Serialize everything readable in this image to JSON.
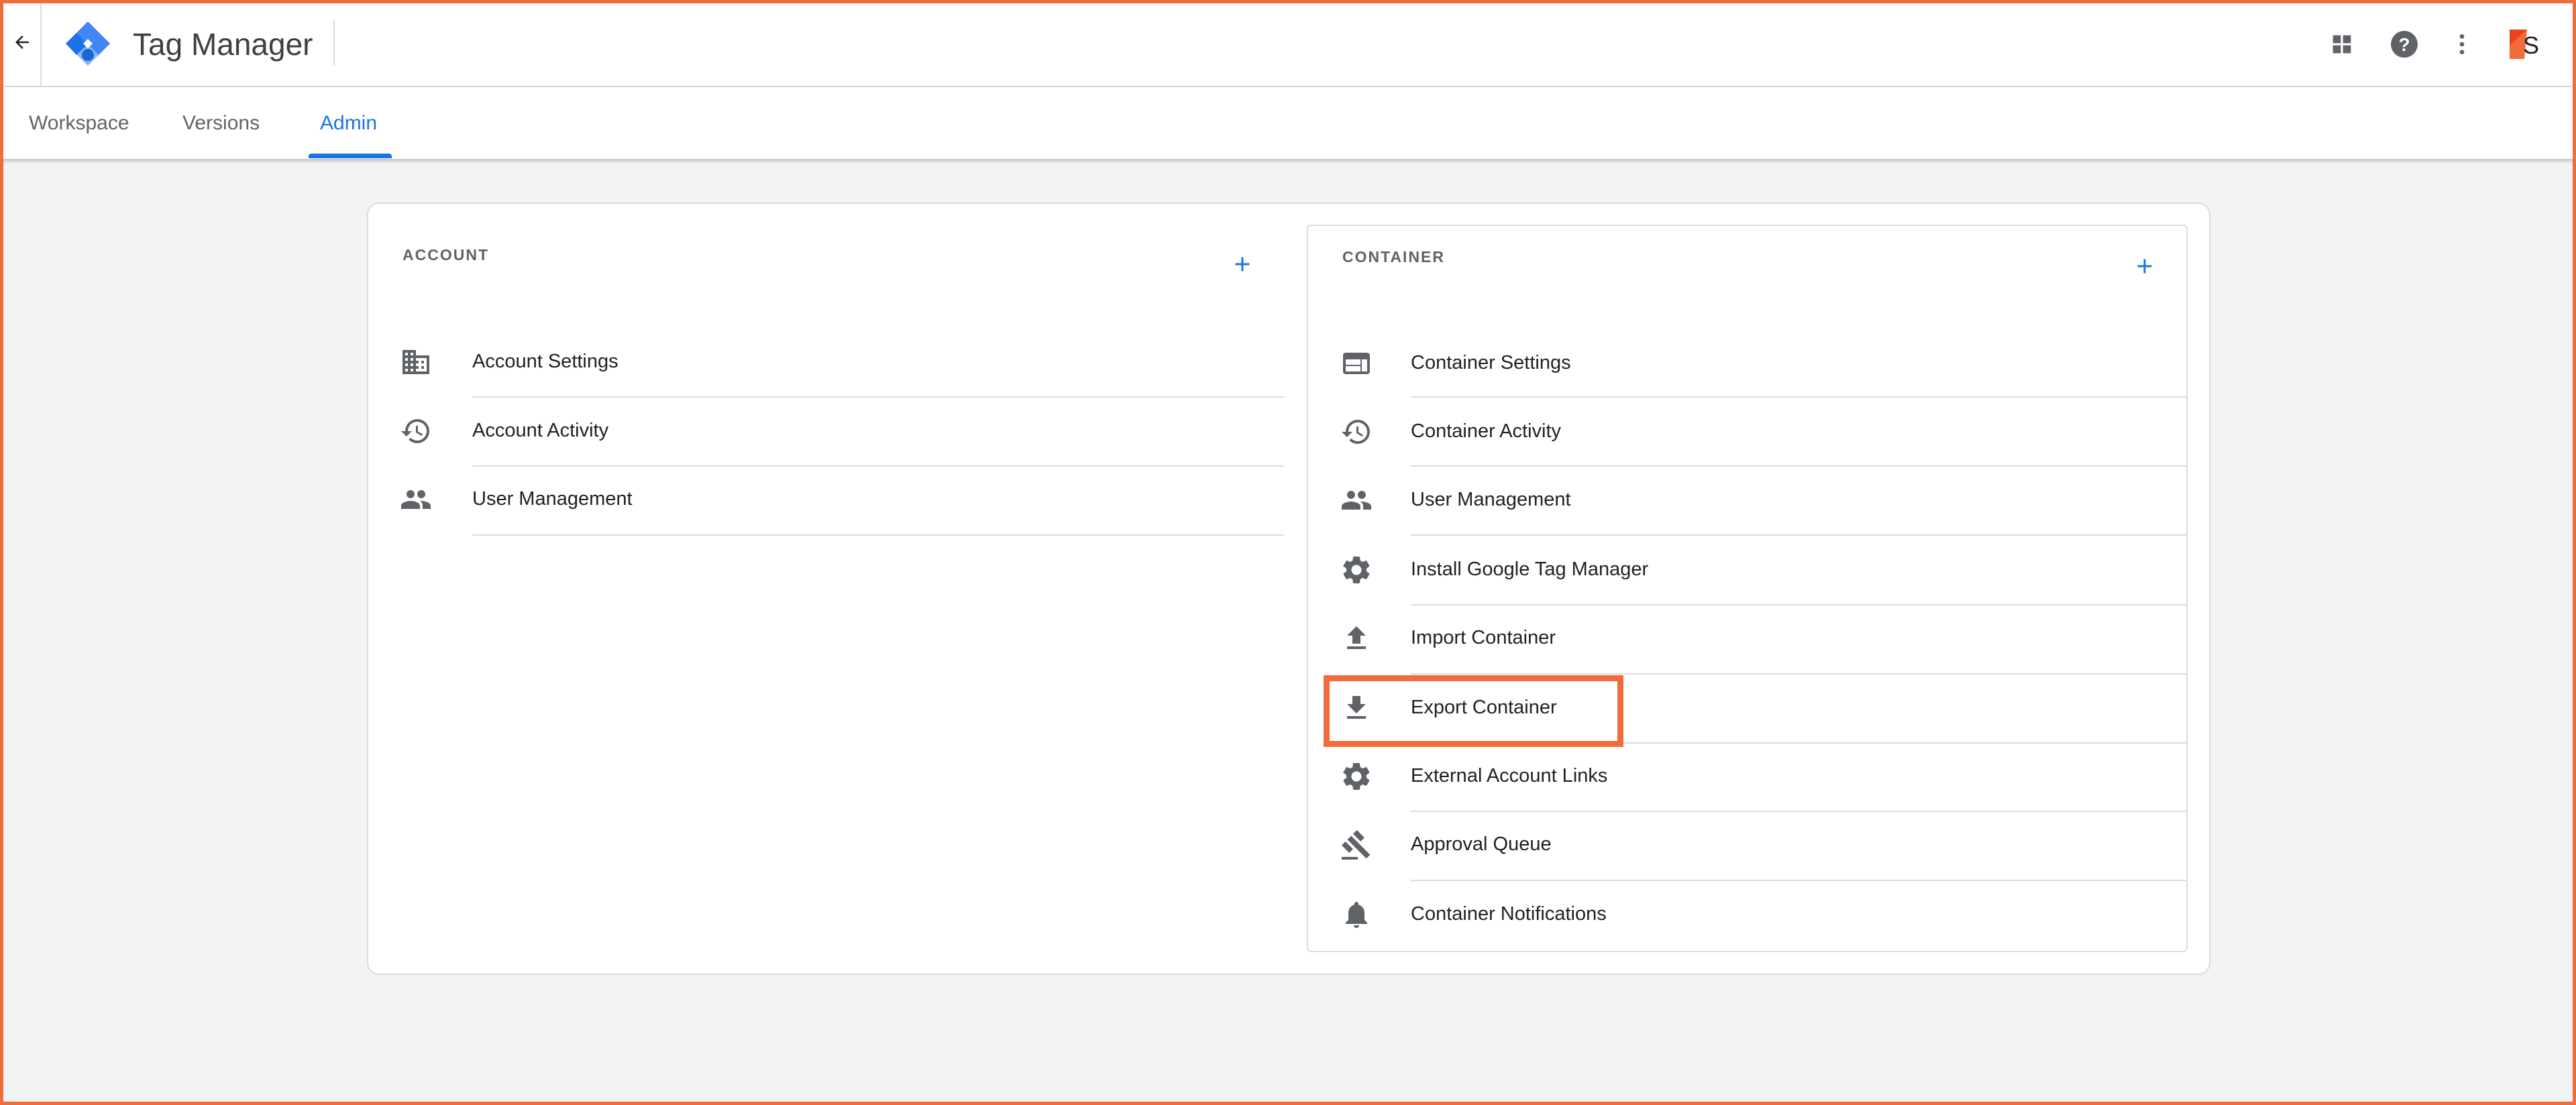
{
  "app": {
    "title": "Tag Manager",
    "accent_color": "#1a73e8",
    "highlight_color": "#f26b3a"
  },
  "header": {
    "back_icon": "arrow-back-icon",
    "icons": [
      "apps-grid-icon",
      "help-icon",
      "more-vert-icon"
    ],
    "avatar_letter": "S"
  },
  "tabs": [
    {
      "label": "Workspace",
      "active": false
    },
    {
      "label": "Versions",
      "active": false
    },
    {
      "label": "Admin",
      "active": true
    }
  ],
  "account": {
    "heading": "ACCOUNT",
    "items": [
      {
        "label": "Account Settings",
        "icon": "building-icon"
      },
      {
        "label": "Account Activity",
        "icon": "history-icon"
      },
      {
        "label": "User Management",
        "icon": "people-icon"
      }
    ]
  },
  "container": {
    "heading": "CONTAINER",
    "items": [
      {
        "label": "Container Settings",
        "icon": "web-window-icon"
      },
      {
        "label": "Container Activity",
        "icon": "history-icon"
      },
      {
        "label": "User Management",
        "icon": "people-icon"
      },
      {
        "label": "Install Google Tag Manager",
        "icon": "gear-icon"
      },
      {
        "label": "Import Container",
        "icon": "upload-icon"
      },
      {
        "label": "Export Container",
        "icon": "download-icon",
        "highlighted": true
      },
      {
        "label": "External Account Links",
        "icon": "gear-icon"
      },
      {
        "label": "Approval Queue",
        "icon": "gavel-icon"
      },
      {
        "label": "Container Notifications",
        "icon": "bell-icon"
      }
    ]
  }
}
